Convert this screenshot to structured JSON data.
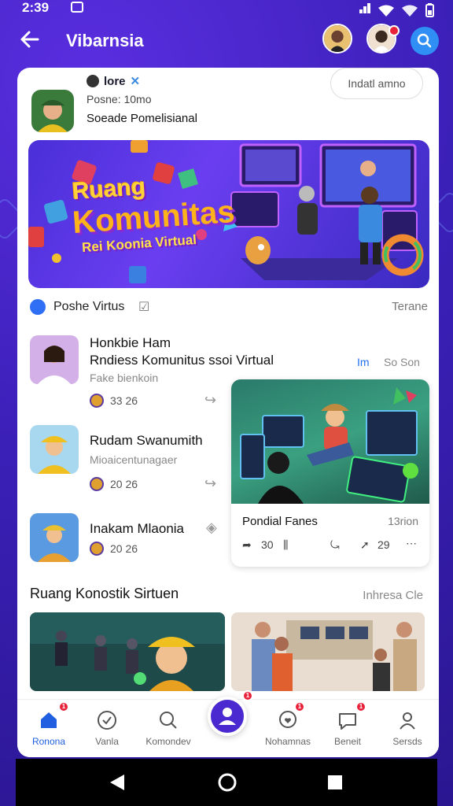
{
  "status_bar": {
    "time": "2:39"
  },
  "header": {
    "title": "Vibarnsia"
  },
  "profile": {
    "name": "lore",
    "subtitle": "Posne: 10mo",
    "description": "Soeade Pomelisianal",
    "follow_label": "Indatl amno"
  },
  "banner": {
    "line1": "Ruang",
    "line2": "Komunitas",
    "line3": "Rei Koonia Virtual"
  },
  "section1": {
    "label": "Poshe Virtus",
    "more": "Terane"
  },
  "feed": [
    {
      "title": "Honkbie Ham",
      "subtitle": "Rndiess Komunitus ssoi Virtual",
      "caption": "Fake bienkoin",
      "meta": "33 26"
    },
    {
      "title": "Rudam Swanumith",
      "caption": "Mioaicentunagaer",
      "meta": "20 26"
    },
    {
      "title": "Inakam Mlaonia",
      "meta": "20 26"
    }
  ],
  "side": {
    "link": "Im",
    "duration": "So Son"
  },
  "featured": {
    "title": "Pondial Fanes",
    "duration": "13rion",
    "views": "30",
    "shares": "29"
  },
  "section2": {
    "label": "Ruang Konostik Sirtuen",
    "more": "Inhresa Cle"
  },
  "bottom_nav": [
    {
      "label": "Ronona",
      "active": true,
      "badge": "1"
    },
    {
      "label": "Vanla"
    },
    {
      "label": "Komondev"
    },
    {
      "label": "",
      "badge": "1"
    },
    {
      "label": "Nohamnas",
      "badge": "1"
    },
    {
      "label": "Beneit",
      "badge": "1"
    },
    {
      "label": "Sersds"
    }
  ],
  "colors": {
    "background": "#3a1fb3",
    "accent_blue": "#2f8ff5",
    "badge_red": "#e8223a",
    "nav_active": "#1f5fe0"
  }
}
